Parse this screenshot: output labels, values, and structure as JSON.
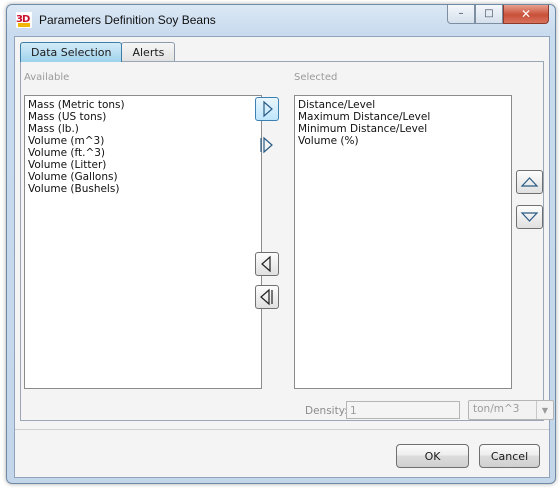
{
  "window": {
    "title": "Parameters Definition Soy Beans",
    "app_icon": "3d-logo-icon",
    "controls": {
      "minimize": "–",
      "maximize": "□",
      "close": "✕"
    }
  },
  "tabs": [
    {
      "label": "Data Selection",
      "active": true
    },
    {
      "label": "Alerts",
      "active": false
    }
  ],
  "available": {
    "label": "Available",
    "items": [
      "Mass (Metric tons)",
      "Mass (US tons)",
      "Mass (lb.)",
      "Volume (m^3)",
      "Volume (ft.^3)",
      "Volume (Litter)",
      "Volume (Gallons)",
      "Volume (Bushels)"
    ]
  },
  "selected": {
    "label": "Selected",
    "items": [
      "Distance/Level",
      "Maximum Distance/Level",
      "Minimum Distance/Level",
      "Volume (%)"
    ]
  },
  "move_buttons": {
    "add": "chevron-right-icon",
    "add_all": "double-chevron-right-icon",
    "remove": "chevron-left-icon",
    "remove_all": "double-chevron-left-icon",
    "move_up": "triangle-up-icon",
    "move_down": "triangle-down-icon"
  },
  "density": {
    "label": "Density:",
    "value": "1",
    "unit": "ton/m^3"
  },
  "buttons": {
    "ok": "OK",
    "cancel": "Cancel"
  },
  "colors": {
    "active_tab": "#a8d8f0",
    "hot_button": "#bee6fd",
    "title_gradient": "#c9dbee"
  }
}
